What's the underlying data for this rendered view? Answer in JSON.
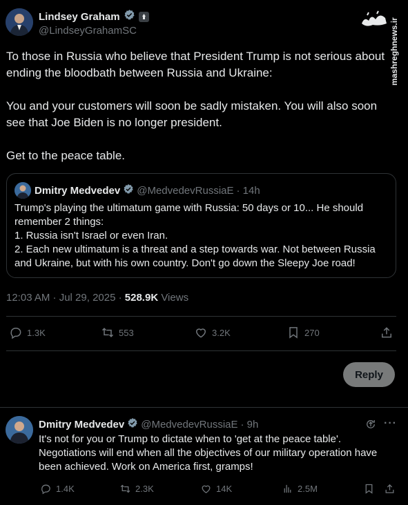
{
  "main_tweet": {
    "author_name": "Lindsey Graham",
    "author_handle": "@LindseyGrahamSC",
    "paragraphs": [
      "To those in Russia who believe that President Trump is not serious about ending the bloodbath between Russia and Ukraine:",
      "You and your customers will soon be sadly mistaken. You will also soon see that Joe Biden is no longer president.",
      "Get to the peace table."
    ],
    "timestamp": "12:03 AM · Jul 29, 2025 ·",
    "views_count": "528.9K",
    "views_label": "Views",
    "actions": {
      "replies": "1.3K",
      "reposts": "553",
      "likes": "3.2K",
      "bookmarks": "270"
    }
  },
  "quoted_tweet": {
    "author_name": "Dmitry Medvedev",
    "author_handle": "@MedvedevRussiaE",
    "time": "· 14h",
    "lines": [
      "Trump's playing the ultimatum game with Russia: 50 days or 10... He should remember 2 things:",
      "1. Russia isn't Israel or even Iran.",
      "2. Each new ultimatum is a threat and a step towards war. Not between Russia and Ukraine, but with his own country. Don't go down the Sleepy Joe road!"
    ]
  },
  "reply_button_label": "Reply",
  "reply_tweet": {
    "author_name": "Dmitry Medvedev",
    "author_handle": "@MedvedevRussiaE",
    "time": "· 9h",
    "text": "It's not for you or Trump to dictate when to 'get at the peace table'. Negotiations will end when all the objectives of our military operation have been achieved. Work on America first, gramps!",
    "actions": {
      "replies": "1.4K",
      "reposts": "2.3K",
      "likes": "14K",
      "views": "2.5M"
    }
  },
  "watermark": {
    "logo_text": "مشرق",
    "site": "mashreghnews.ir"
  },
  "colors": {
    "background": "#000000",
    "text": "#e7e9ea",
    "muted": "#71767b",
    "verified": "#829aab",
    "border": "#2f3336"
  }
}
